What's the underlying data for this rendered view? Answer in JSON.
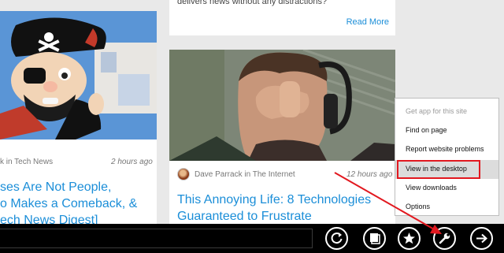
{
  "left_card": {
    "meta_source": "k in Tech News",
    "meta_time": "2 hours ago",
    "headline_lines": [
      "ses Are Not People,",
      "o Makes a Comeback, &",
      "ech News Digest]"
    ]
  },
  "top_card": {
    "text": "delivers news without any distractions?",
    "read_more": "Read More"
  },
  "mid_card": {
    "author": "Dave Parrack",
    "in_word": "in",
    "category": "The Internet",
    "time": "12 hours ago",
    "headline_lines": [
      "This Annoying Life: 8 Technologies",
      "Guaranteed to Frustrate"
    ]
  },
  "context_menu": {
    "items": [
      {
        "label": "Get app for this site",
        "disabled": true
      },
      {
        "label": "Find on page",
        "disabled": false
      },
      {
        "label": "Report website problems",
        "disabled": false
      },
      {
        "label": "View in the desktop",
        "disabled": false,
        "highlighted": true
      },
      {
        "label": "View downloads",
        "disabled": false
      },
      {
        "label": "Options",
        "disabled": false
      }
    ]
  },
  "app_bar": {
    "buttons": [
      "refresh-icon",
      "tabs-icon",
      "favorites-star-icon",
      "page-tools-wrench-icon",
      "forward-arrow-icon"
    ]
  },
  "colors": {
    "link": "#1b8ed8",
    "highlight_box": "#e2181f",
    "app_bar": "#000000"
  }
}
